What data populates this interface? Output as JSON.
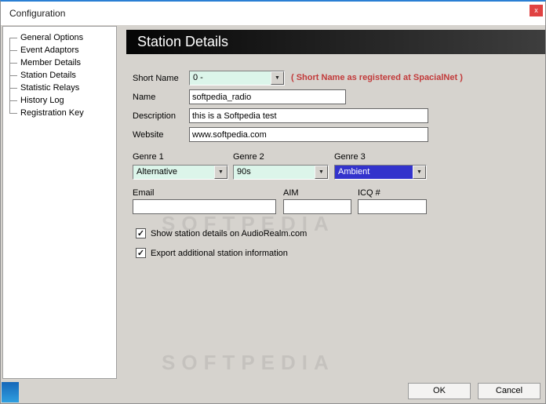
{
  "window": {
    "title": "Configuration"
  },
  "icons": {
    "close": "x",
    "arrow": "▼",
    "check": "✓"
  },
  "colors": {
    "accent_top": "#2a7fd4",
    "close_red": "#e04343",
    "header_dark": "#111111",
    "combo_green": "#dcf5ea",
    "selection_blue": "#3333cc",
    "note_red": "#c23a3a",
    "panel_gray": "#d6d3ce"
  },
  "sidebar": {
    "items": [
      {
        "label": "General Options"
      },
      {
        "label": "Event Adaptors"
      },
      {
        "label": "Member Details"
      },
      {
        "label": "Station Details"
      },
      {
        "label": "Statistic Relays"
      },
      {
        "label": "History Log"
      },
      {
        "label": "Registration Key"
      }
    ]
  },
  "main": {
    "header": "Station Details",
    "short_name": {
      "label": "Short Name",
      "value": "0 -",
      "note": "( Short Name as registered at SpacialNet )"
    },
    "name": {
      "label": "Name",
      "value": "softpedia_radio"
    },
    "description": {
      "label": "Description",
      "value": "this is a Softpedia test"
    },
    "website": {
      "label": "Website",
      "value": "www.softpedia.com"
    },
    "genre1": {
      "label": "Genre 1",
      "value": "Alternative"
    },
    "genre2": {
      "label": "Genre 2",
      "value": "90s"
    },
    "genre3": {
      "label": "Genre 3",
      "value": "Ambient"
    },
    "email": {
      "label": "Email",
      "value": ""
    },
    "aim": {
      "label": "AIM",
      "value": ""
    },
    "icq": {
      "label": "ICQ #",
      "value": ""
    },
    "checkbox1": {
      "label": "Show station details on AudioRealm.com",
      "checked": true
    },
    "checkbox2": {
      "label": "Export additional station information",
      "checked": true
    },
    "ok": "OK",
    "cancel": "Cancel",
    "watermark": "SOFTPEDIA"
  }
}
